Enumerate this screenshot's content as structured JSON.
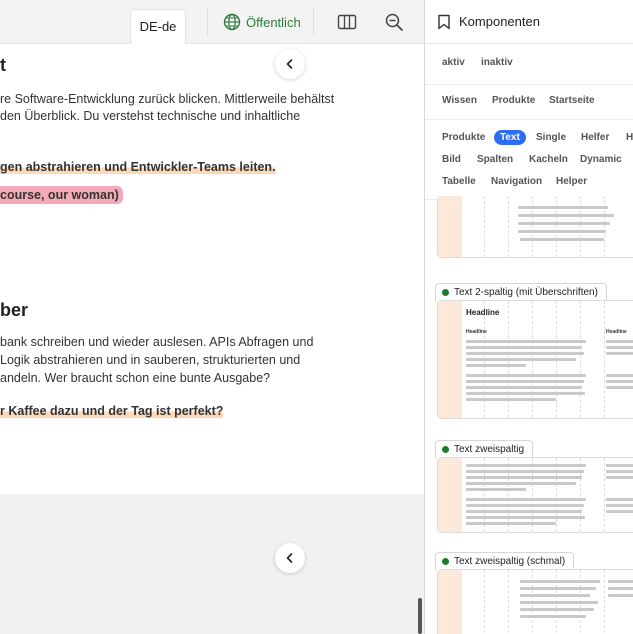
{
  "toolbar": {
    "language_tab": "DE-de",
    "visibility_label": "Öffentlich",
    "columns_icon": "columns-icon",
    "zoom_icon": "zoom-out-icon"
  },
  "content": {
    "section1_title_fragment": "t",
    "section1_lines": [
      "re Software-Entwicklung zurück blicken. Mittlerweile behältst",
      "den Überblick. Du verstehst technische und inhaltliche"
    ],
    "section1_highlight": "gen abstrahieren und Entwickler-Teams leiten.",
    "section1_pink": "course, our woman)",
    "section2_title_fragment": "ber",
    "section2_lines": [
      "bank schreiben und wieder auslesen. APIs Abfragen und",
      "Logik abstrahieren und in sauberen, strukturierten und",
      "andeln. Wer braucht schon eine bunte Ausgabe?"
    ],
    "section2_highlight": "r Kaffee dazu und der Tag ist perfekt?"
  },
  "panel": {
    "title": "Komponenten",
    "status_filters": [
      "aktiv",
      "inaktiv"
    ],
    "page_filters": [
      "Wissen",
      "Produkte",
      "Startseite"
    ],
    "type_filters_row1": [
      "Produkte",
      "Text",
      "Single",
      "Helfer",
      "H"
    ],
    "type_filters_row2": [
      "Bild",
      "Spalten",
      "Kacheln",
      "Dynamic"
    ],
    "type_filters_row3": [
      "Tabelle",
      "Navigation",
      "Helper"
    ],
    "active_filter": "Text",
    "cards": [
      {
        "label": "Text 2-spaltig (mit Überschriften)",
        "headline": "Headline",
        "subheads": [
          "Headline",
          "Headline"
        ]
      },
      {
        "label": "Text zweispaltig"
      },
      {
        "label": "Text zweispaltig (schmal)"
      }
    ]
  },
  "colors": {
    "accent": "#2d6df6",
    "status_green": "#1e7d2a",
    "highlight_orange": "#fbd8b8",
    "highlight_pink": "#f4a9b8"
  }
}
